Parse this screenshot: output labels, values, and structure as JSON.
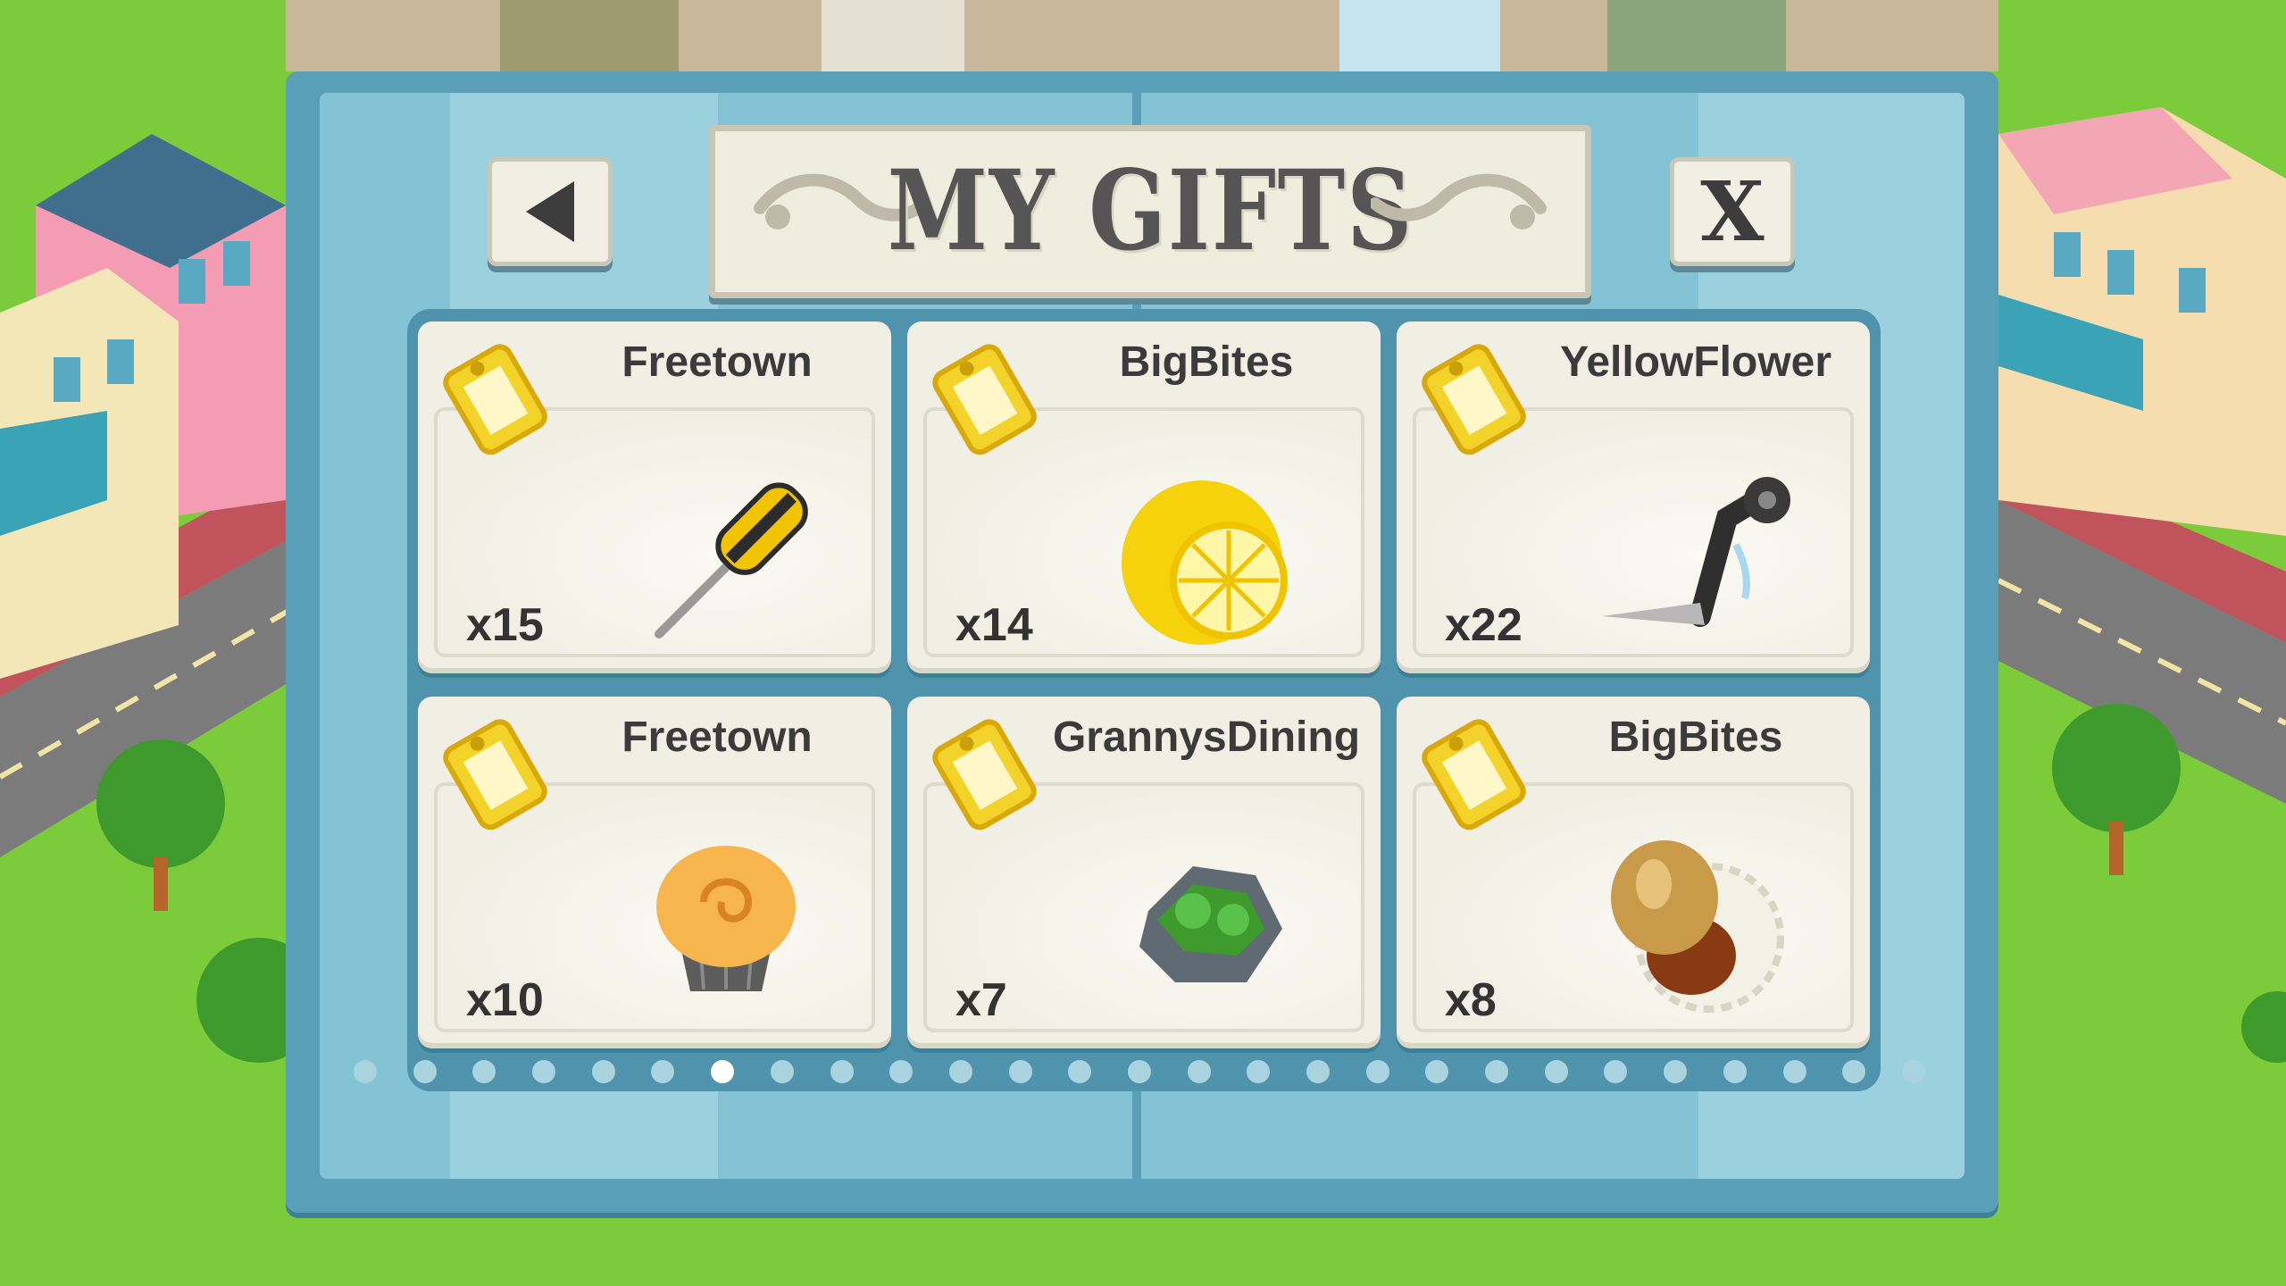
{
  "header": {
    "title": "MY GIFTS"
  },
  "buttons": {
    "back": "back-arrow",
    "close": "X"
  },
  "gifts": [
    {
      "sender": "Freetown",
      "quantity": "x15",
      "item_icon": "screwdriver-icon"
    },
    {
      "sender": "BigBites",
      "quantity": "x14",
      "item_icon": "lemon-icon"
    },
    {
      "sender": "YellowFlower",
      "quantity": "x22",
      "item_icon": "crank-handle-icon"
    },
    {
      "sender": "Freetown",
      "quantity": "x10",
      "item_icon": "muffin-icon"
    },
    {
      "sender": "GrannysDining",
      "quantity": "x7",
      "item_icon": "mossy-rock-icon"
    },
    {
      "sender": "BigBites",
      "quantity": "x8",
      "item_icon": "acorn-icon"
    }
  ],
  "pagination": {
    "total_pages": 27,
    "current_page": 7
  },
  "colors": {
    "panel": "#5a9fb8",
    "panel_light": "#84c3d6",
    "card": "#f1efe4",
    "tag": "#f3d22a",
    "grass": "#7ccb3a"
  }
}
